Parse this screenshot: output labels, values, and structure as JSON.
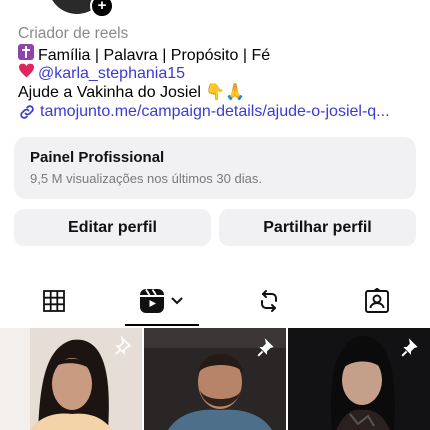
{
  "profile": {
    "category": "Criador de reels",
    "bio_line1": "Família | Palavra | Propósito | Fé",
    "bio_line2_mention": "@karla_stephania15",
    "bio_line3": "Ajude a Vakinha do Josiel 👇🙏",
    "link": "tamojunto.me/campaign-details/ajude-o-josiel-q..."
  },
  "professional_panel": {
    "title": "Painel Profissional",
    "subtitle": "9,5 M visualizações nos últimos 30 dias."
  },
  "actions": {
    "edit_label": "Editar perfil",
    "share_label": "Partilhar perfil"
  },
  "tabs": [
    {
      "name": "grid",
      "icon": "grid-icon",
      "active": false
    },
    {
      "name": "reels",
      "icon": "reels-icon",
      "active": true
    },
    {
      "name": "reposts",
      "icon": "repost-icon",
      "active": false
    },
    {
      "name": "tagged",
      "icon": "tagged-user-icon",
      "active": false
    }
  ],
  "colors": {
    "link": "#3a3ad6",
    "card_bg": "#f1f1f4",
    "muted_text": "#7a7a7a"
  }
}
